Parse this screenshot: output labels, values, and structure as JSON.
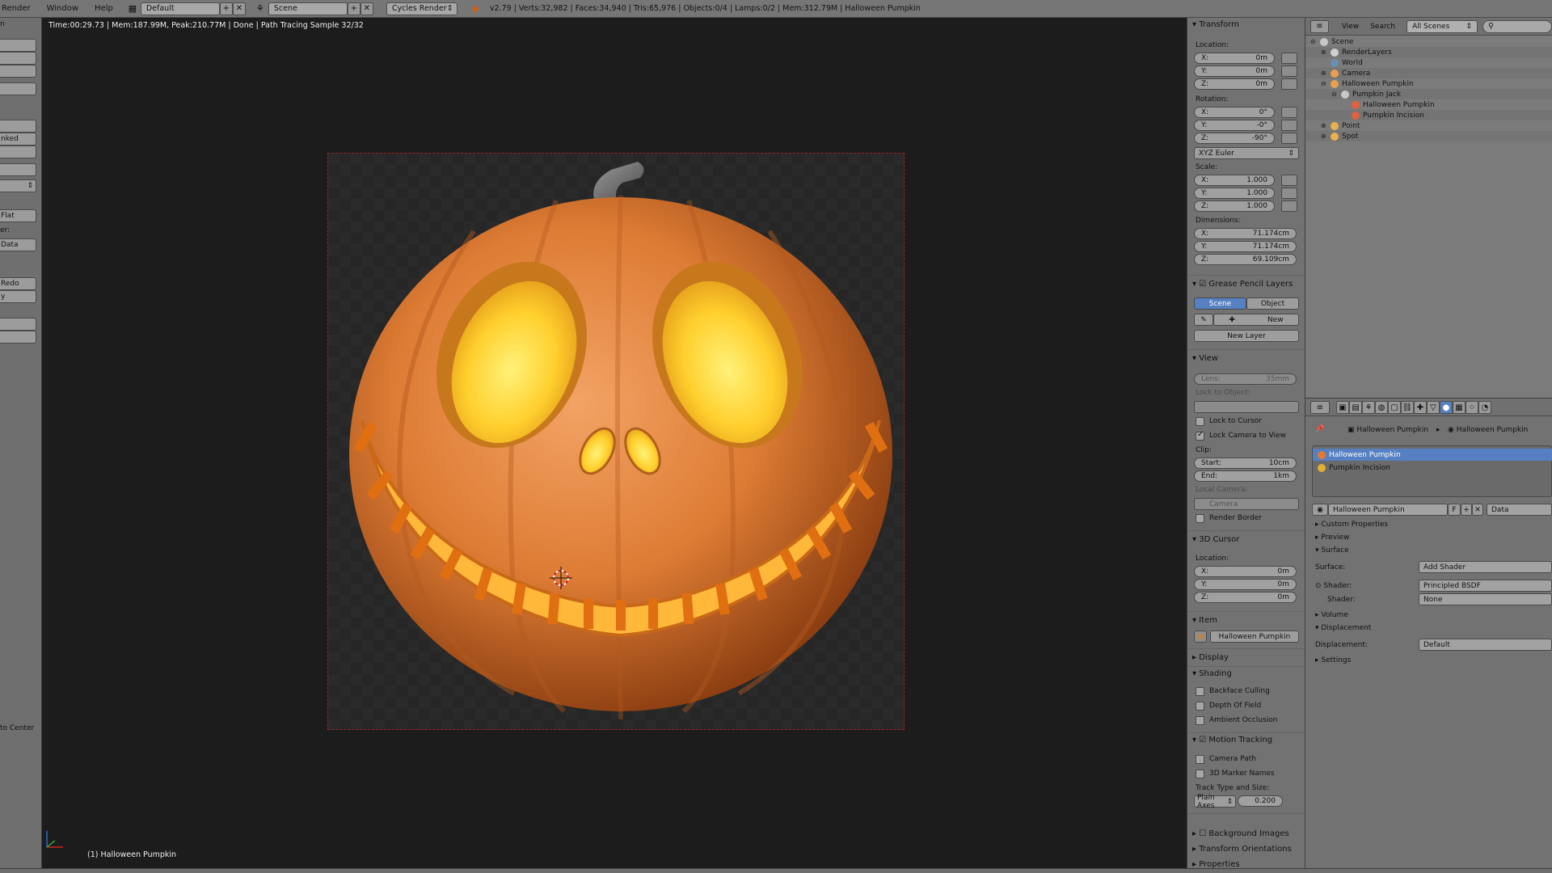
{
  "topbar": {
    "menus": [
      "Render",
      "Window",
      "Help"
    ],
    "screen_layout": "Default",
    "scene": "Scene",
    "render_engine": "Cycles Render",
    "stats": "v2.79 | Verts:32,982 | Faces:34,940 | Tris:65,976 | Objects:0/4 | Lamps:0/2 | Mem:312.79M | Halloween Pumpkin"
  },
  "leftshelf": {
    "labels": [
      "n",
      "nked",
      "Flat",
      "er:",
      "Data Layo",
      "Redo",
      "y",
      "to Center"
    ]
  },
  "viewport": {
    "render_info": "Time:00:29.73 | Mem:187.99M, Peak:210.77M | Done | Path Tracing Sample 32/32",
    "active_object": "(1) Halloween Pumpkin"
  },
  "npanel": {
    "transform": {
      "title": "Transform",
      "location_label": "Location:",
      "location": [
        {
          "k": "X:",
          "v": "0m"
        },
        {
          "k": "Y:",
          "v": "0m"
        },
        {
          "k": "Z:",
          "v": "0m"
        }
      ],
      "rotation_label": "Rotation:",
      "rotation": [
        {
          "k": "X:",
          "v": "0°"
        },
        {
          "k": "Y:",
          "v": "-0°"
        },
        {
          "k": "Z:",
          "v": "-90°"
        }
      ],
      "rotation_mode": "XYZ Euler",
      "scale_label": "Scale:",
      "scale": [
        {
          "k": "X:",
          "v": "1.000"
        },
        {
          "k": "Y:",
          "v": "1.000"
        },
        {
          "k": "Z:",
          "v": "1.000"
        }
      ],
      "dimensions_label": "Dimensions:",
      "dimensions": [
        {
          "k": "X:",
          "v": "71.174cm"
        },
        {
          "k": "Y:",
          "v": "71.174cm"
        },
        {
          "k": "Z:",
          "v": "69.109cm"
        }
      ]
    },
    "grease_pencil": {
      "title": "Grease Pencil Layers",
      "tab_scene": "Scene",
      "tab_object": "Object",
      "new_label": "New",
      "new_layer_label": "New Layer"
    },
    "view": {
      "title": "View",
      "lens_label": "Lens:",
      "lens_value": "35mm",
      "lock_to_object": "Lock to Object:",
      "lock_to_cursor": "Lock to Cursor",
      "lock_camera_to_view": "Lock Camera to View",
      "clip_label": "Clip:",
      "clip": [
        {
          "k": "Start:",
          "v": "10cm"
        },
        {
          "k": "End:",
          "v": "1km"
        }
      ],
      "local_camera": "Local Camera:",
      "camera": "Camera",
      "render_border": "Render Border"
    },
    "cursor": {
      "title": "3D Cursor",
      "location_label": "Location:",
      "location": [
        {
          "k": "X:",
          "v": "0m"
        },
        {
          "k": "Y:",
          "v": "0m"
        },
        {
          "k": "Z:",
          "v": "0m"
        }
      ]
    },
    "item": {
      "title": "Item",
      "name": "Halloween Pumpkin"
    },
    "display": {
      "title": "Display"
    },
    "shading": {
      "title": "Shading",
      "backface_culling": "Backface Culling",
      "depth_of_field": "Depth Of Field",
      "ambient_occlusion": "Ambient Occlusion"
    },
    "motion_tracking": {
      "title": "Motion Tracking",
      "camera_path": "Camera Path",
      "marker_names": "3D Marker Names",
      "track_type_label": "Track Type and Size:",
      "track_type": "Plain Axes",
      "track_size": "0.200"
    },
    "background_images": "Background Images",
    "transform_orientations": "Transform Orientations",
    "properties": "Properties"
  },
  "outliner": {
    "view_menu": "View",
    "search_menu": "Search",
    "display_mode": "All Scenes",
    "items": [
      {
        "label": "Scene",
        "indent": 0,
        "color": "#c7c7c7",
        "expander": "⊖"
      },
      {
        "label": "RenderLayers",
        "indent": 1,
        "color": "#d0d0d0",
        "expander": "⊕"
      },
      {
        "label": "World",
        "indent": 1,
        "color": "#6a8fb0",
        "expander": ""
      },
      {
        "label": "Camera",
        "indent": 1,
        "color": "#e8a050",
        "expander": "⊕"
      },
      {
        "label": "Halloween Pumpkin",
        "indent": 1,
        "color": "#e8a050",
        "expander": "⊖"
      },
      {
        "label": "Pumpkin Jack",
        "indent": 2,
        "color": "#c9c9c9",
        "expander": "⊖"
      },
      {
        "label": "Halloween Pumpkin",
        "indent": 3,
        "color": "#e06040",
        "expander": ""
      },
      {
        "label": "Pumpkin Incision",
        "indent": 3,
        "color": "#e06040",
        "expander": ""
      },
      {
        "label": "Point",
        "indent": 1,
        "color": "#e8b050",
        "expander": "⊕"
      },
      {
        "label": "Spot",
        "indent": 1,
        "color": "#e8b050",
        "expander": "⊕"
      }
    ]
  },
  "properties": {
    "breadcrumb_object": "Halloween Pumpkin",
    "breadcrumb_material": "Halloween Pumpkin",
    "slots": [
      {
        "label": "Halloween Pumpkin",
        "selected": true,
        "color": "#e07a30"
      },
      {
        "label": "Pumpkin Incision",
        "selected": false,
        "color": "#e0b030"
      }
    ],
    "material_name": "Halloween Pumpkin",
    "fake_user": "F",
    "link_mode": "Data",
    "sections": {
      "custom_properties": "Custom Properties",
      "preview": "Preview",
      "surface": "Surface",
      "surface_label": "Surface:",
      "surface_value": "Add Shader",
      "shader1_label": "Shader:",
      "shader1_value": "Principled BSDF",
      "shader2_label": "Shader:",
      "shader2_value": "None",
      "volume": "Volume",
      "displacement": "Displacement",
      "displacement_label": "Displacement:",
      "displacement_value": "Default",
      "settings": "Settings"
    }
  },
  "colors": {
    "selection_blue": "#5680c2",
    "camera_border": "#a02020",
    "pumpkin_orange": "#d9772d",
    "glow_yellow": "#ffd64a"
  }
}
